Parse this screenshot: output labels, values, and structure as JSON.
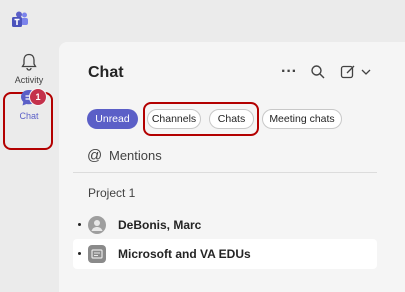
{
  "rail": {
    "activity_label": "Activity",
    "chat_label": "Chat",
    "chat_badge": "1"
  },
  "panel": {
    "title": "Chat",
    "filters": [
      "Unread",
      "Channels",
      "Chats",
      "Meeting chats"
    ],
    "mentions_label": "Mentions",
    "group_label": "Project 1",
    "chats": [
      {
        "name": "DeBonis, Marc"
      },
      {
        "name": "Microsoft and VA EDUs"
      }
    ]
  },
  "colors": {
    "accent": "#5b5fc7",
    "badge": "#c4314b",
    "highlight_box": "#b30000"
  }
}
